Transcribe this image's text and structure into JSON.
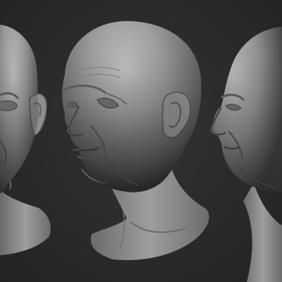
{
  "scene": {
    "description_visible_text": "",
    "background_color": "#2b2b2b",
    "material_color": "#9a9a9a",
    "views": [
      {
        "name": "front-three-quarter-left"
      },
      {
        "name": "three-quarter"
      },
      {
        "name": "profile-right"
      }
    ]
  }
}
